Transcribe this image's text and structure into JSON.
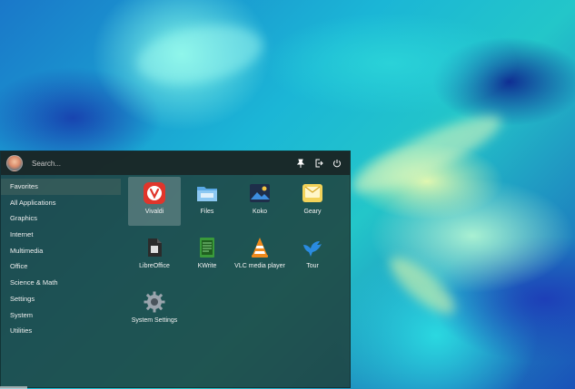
{
  "search": {
    "placeholder": "Search..."
  },
  "categories": [
    "Favorites",
    "All Applications",
    "Graphics",
    "Internet",
    "Multimedia",
    "Office",
    "Science & Math",
    "Settings",
    "System",
    "Utilities"
  ],
  "apps": [
    {
      "label": "Vivaldi",
      "icon": "vivaldi-icon"
    },
    {
      "label": "Files",
      "icon": "folder-icon"
    },
    {
      "label": "Koko",
      "icon": "koko-icon"
    },
    {
      "label": "Geary",
      "icon": "mail-icon"
    },
    {
      "label": "LibreOffice",
      "icon": "libreoffice-icon"
    },
    {
      "label": "KWrite",
      "icon": "kwrite-icon"
    },
    {
      "label": "VLC media player",
      "icon": "vlc-icon"
    },
    {
      "label": "Tour",
      "icon": "bird-icon"
    },
    {
      "label": "System Settings",
      "icon": "gear-icon"
    }
  ],
  "colors": {
    "accent": "#e0352b",
    "vlc": "#f08a1c",
    "tour": "#2a8be0"
  }
}
